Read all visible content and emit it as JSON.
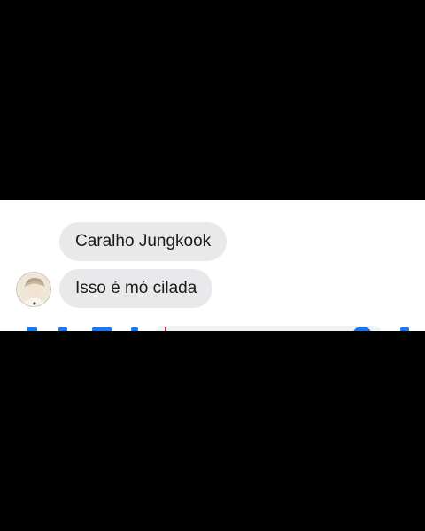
{
  "messages": [
    {
      "text": "Caralho Jungkook"
    },
    {
      "text": "Isso é mó cilada"
    }
  ],
  "contact": {
    "avatar_icon": "user-photo-icon"
  },
  "composer": {
    "icons": [
      "camera-icon",
      "image-icon",
      "mic-icon"
    ],
    "emoji_icon": "emoji-icon",
    "like_icon": "thumbs-up-icon"
  },
  "colors": {
    "bubble_bg": "#e9e9eb",
    "text": "#1b1b1b",
    "accent": "#1877f2",
    "letterbox": "#000000"
  }
}
